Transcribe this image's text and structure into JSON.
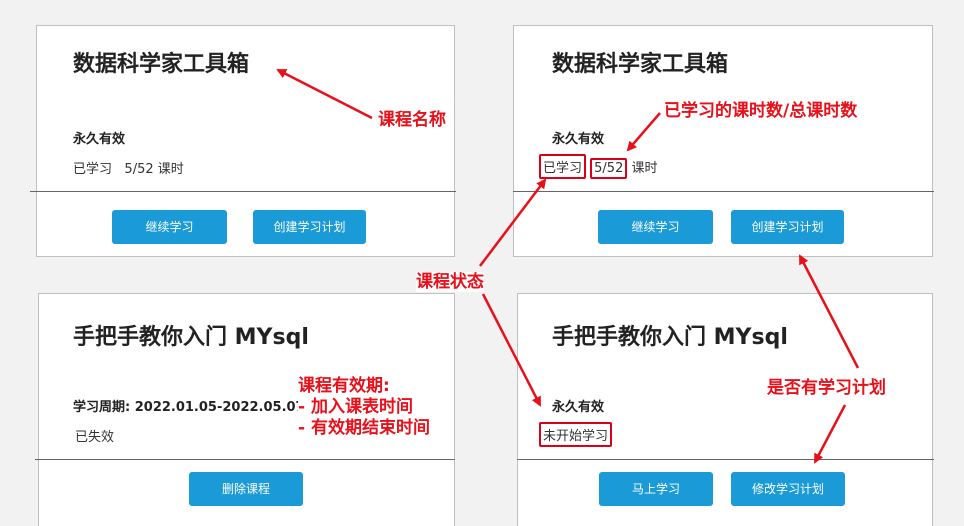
{
  "cards": [
    {
      "title": "数据科学家工具箱",
      "validity": "永久有效",
      "status": "已学习",
      "progress": "5/52",
      "unit": "课时",
      "buttons": [
        "继续学习",
        "创建学习计划"
      ]
    },
    {
      "title": "数据科学家工具箱",
      "validity": "永久有效",
      "status": "已学习",
      "progress": "5/52",
      "unit": "课时",
      "buttons": [
        "继续学习",
        "创建学习计划"
      ]
    },
    {
      "title": "手把手教你入门 MYsql",
      "validity": "学习周期: 2022.01.05-2022.05.07",
      "status": "已失效",
      "buttons": [
        "删除课程"
      ]
    },
    {
      "title": "手把手教你入门 MYsql",
      "validity": "永久有效",
      "status": "未开始学习",
      "buttons": [
        "马上学习",
        "修改学习计划"
      ]
    }
  ],
  "annotations": {
    "course_name": "课程名称",
    "lessons_learned": "已学习的课时数/总课时数",
    "course_status": "课程状态",
    "validity_title": "课程有效期:",
    "validity_line1": "- 加入课表时间",
    "validity_line2": "- 有效期结束时间",
    "has_plan": "是否有学习计划"
  },
  "colors": {
    "button": "#1a9ad6",
    "annotation": "#e8101a",
    "highlight_box": "#d9001b"
  }
}
